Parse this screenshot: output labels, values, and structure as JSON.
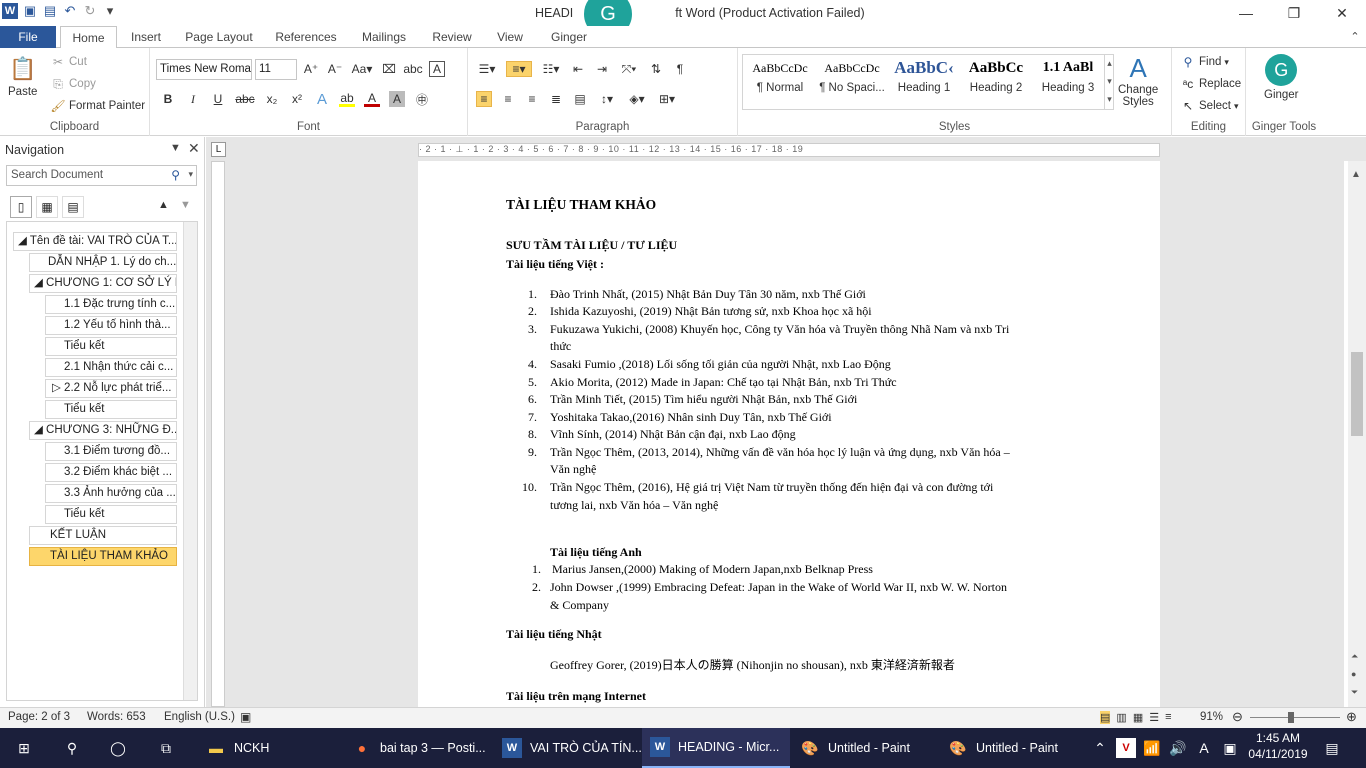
{
  "window": {
    "title": "HEADING - Microsoft Word (Product Activation Failed)",
    "title_left": "HEADI",
    "title_right": "ft Word (Product Activation Failed)",
    "ginger_letter": "G"
  },
  "tabs": [
    "File",
    "Home",
    "Insert",
    "Page Layout",
    "References",
    "Mailings",
    "Review",
    "View",
    "Ginger"
  ],
  "clipboard": {
    "paste": "Paste",
    "cut": "Cut",
    "copy": "Copy",
    "format_painter": "Format Painter",
    "label": "Clipboard"
  },
  "font": {
    "family": "Times New Roma",
    "size": "11",
    "bold": "B",
    "italic": "I",
    "underline": "U",
    "strike": "abc",
    "sub": "x₂",
    "sup": "x²",
    "label": "Font"
  },
  "paragraph": {
    "label": "Paragraph",
    "pilcrow": "¶"
  },
  "styles": {
    "label": "Styles",
    "items": [
      {
        "preview": "AaBbCcDc",
        "name": "¶ Normal"
      },
      {
        "preview": "AaBbCcDc",
        "name": "¶ No Spaci..."
      },
      {
        "preview": "AaBbC‹",
        "name": "Heading 1"
      },
      {
        "preview": "AaBbCc",
        "name": "Heading 2"
      },
      {
        "preview": "1.1  AaBl",
        "name": "Heading 3"
      }
    ],
    "change": "Change",
    "change2": "Styles"
  },
  "editing": {
    "label": "Editing",
    "find": "Find",
    "replace": "Replace",
    "select": "Select"
  },
  "ginger_tools": {
    "name": "Ginger",
    "label": "Ginger Tools"
  },
  "nav": {
    "title": "Navigation",
    "search_placeholder": "Search Document",
    "items": [
      "Tên đề tài: VAI TRÒ CỦA T...",
      "DẪN NHẬP 1. Lý do ch...",
      "CHƯƠNG 1: CƠ SỞ LÝ L...",
      "1.1 Đặc trưng tính c...",
      "1.2 Yếu tố hình thà...",
      "Tiểu kết",
      "2.1 Nhận thức cải c...",
      "2.2 Nỗ lực phát triể...",
      "Tiểu kết",
      "CHƯƠNG 3:  NHỮNG Đ...",
      "3.1 Điểm tương đồ...",
      "3.2 Điểm khác biệt ...",
      "3.3 Ảnh hưởng của ...",
      "Tiểu kết",
      "KẾT LUẬN",
      "TÀI LIỆU THAM KHẢO"
    ]
  },
  "ruler": "· 2 · 1 · ⊥ · 1 · 2 · 3 · 4 · 5 · 6 · 7 · 8 · 9 · 10 · 11 · 12 · 13 · 14 · 15 · 16 · 17 · 18 · 19",
  "doc": {
    "title": "TÀI LIỆU THAM KHẢO",
    "sub": "SƯU TẦM TÀI LIỆU / TƯ LIỆU",
    "viet": "Tài liệu tiếng Việt :",
    "viet_list": [
      [
        "1.",
        "Đào Trinh Nhất, (2015) Nhật Bản Duy Tân 30 năm, nxb Thế Giới"
      ],
      [
        "2.",
        "Ishida Kazuyoshi, (2019) Nhật Bản tương sử, nxb Khoa học xã hội"
      ],
      [
        "3.",
        "Fukuzawa Yukichi, (2008) Khuyến học, Công ty Văn hóa và Truyền thông Nhã Nam và nxb Tri"
      ],
      [
        "",
        "thức"
      ],
      [
        "4.",
        "Sasaki Fumio ,(2018) Lối sống tối giản của người Nhật, nxb Lao Động"
      ],
      [
        "5.",
        "Akio Morita, (2012) Made in Japan: Chế tạo tại Nhật Bản, nxb Tri Thức"
      ],
      [
        "6.",
        "Trần Minh Tiết, (2015) Tìm hiểu người  Nhật Bản, nxb Thế Giới"
      ],
      [
        "7.",
        "Yoshitaka Takao,(2016) Nhân sinh Duy Tân, nxb Thế Giới"
      ],
      [
        "8.",
        "Vĩnh Sính, (2014) Nhật Bản cận đại, nxb Lao động"
      ],
      [
        "9.",
        "Trần Ngọc  Thêm, (2013, 2014), Những vấn đề văn hóa học lý luận và ứng dụng, nxb Văn hóa –"
      ],
      [
        "",
        "Văn nghệ"
      ],
      [
        "10.",
        "Trần Ngọc  Thêm, (2016),   Hệ giá  trị Việt Nam từ truyền thống đến hiện đại và con đường tới"
      ],
      [
        "",
        "tương lai, nxb Văn hóa – Văn nghệ"
      ]
    ],
    "eng": "Tài liệu tiếng Anh",
    "eng_list": [
      [
        "1.",
        "Marius Jansen,(2000) Making of Modern Japan,nxb Belknap Press"
      ],
      [
        "2.",
        "John Dowser  ,(1999) Embracing Defeat: Japan in the Wake of World War II, nxb W. W.  Norton"
      ],
      [
        "",
        "& Company"
      ]
    ],
    "jp": "Tài liệu tiếng Nhật",
    "jp_item": "Geoffrey Gorer,  (2019)日本人の勝算 (Nihonjin no shousan), nxb 東洋経済新報者",
    "net": "Tài liệu trên mạng Internet"
  },
  "status": {
    "page": "Page: 2 of 3",
    "words": "Words: 653",
    "lang": "English (U.S.)",
    "zoom": "91%"
  },
  "taskbar": {
    "items": [
      "NCKH",
      "bai tap 3 — Posti...",
      "VAI TRÒ CỦA TÍN...",
      "HEADING - Micr...",
      "Untitled - Paint",
      "Untitled - Paint"
    ],
    "time": "1:45 AM",
    "date": "04/11/2019"
  }
}
